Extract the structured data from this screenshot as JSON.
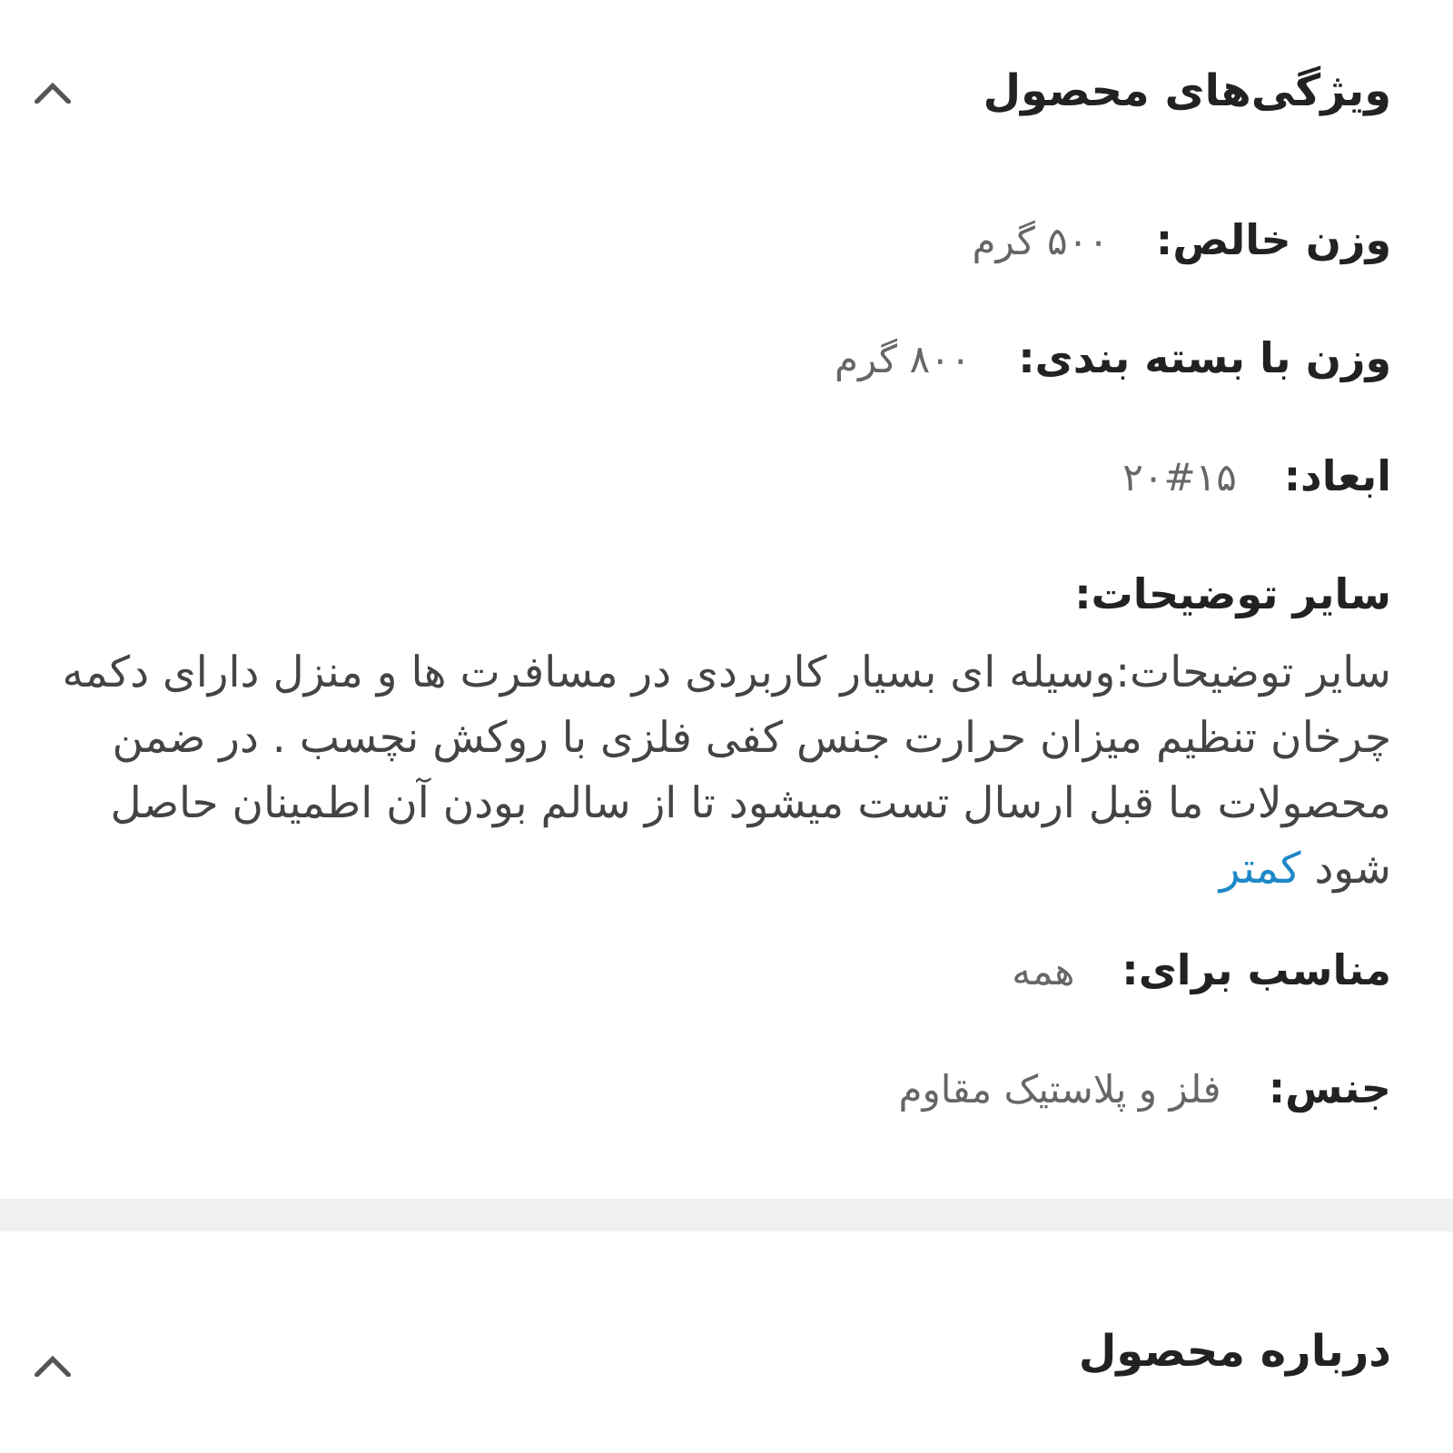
{
  "sections": [
    {
      "title": "ویژگی‌های محصول",
      "expanded": true,
      "specs": [
        {
          "label": "وزن خالص:",
          "value": "۵۰۰ گرم"
        },
        {
          "label": "وزن با بسته بندی:",
          "value": "۸۰۰ گرم"
        },
        {
          "label": "ابعاد:",
          "value": "۲۰#۱۵"
        }
      ],
      "description": {
        "label": "سایر توضیحات:",
        "text": "سایر توضیحات:وسیله ای بسیار کاربردی در مسافرت ها و منزل دارای دکمه چرخان تنظیم میزان حرارت جنس کفی فلزی با روکش نچسب . در ضمن محصولات ما قبل ارسال تست میشود تا از سالم بودن آن اطمینان حاصل شود",
        "link": "کمتر"
      },
      "more_specs": [
        {
          "label": "مناسب برای:",
          "value": "همه"
        },
        {
          "label": "جنس:",
          "value": "فلز و پلاستیک مقاوم"
        }
      ]
    },
    {
      "title": "درباره محصول",
      "expanded": true
    }
  ]
}
